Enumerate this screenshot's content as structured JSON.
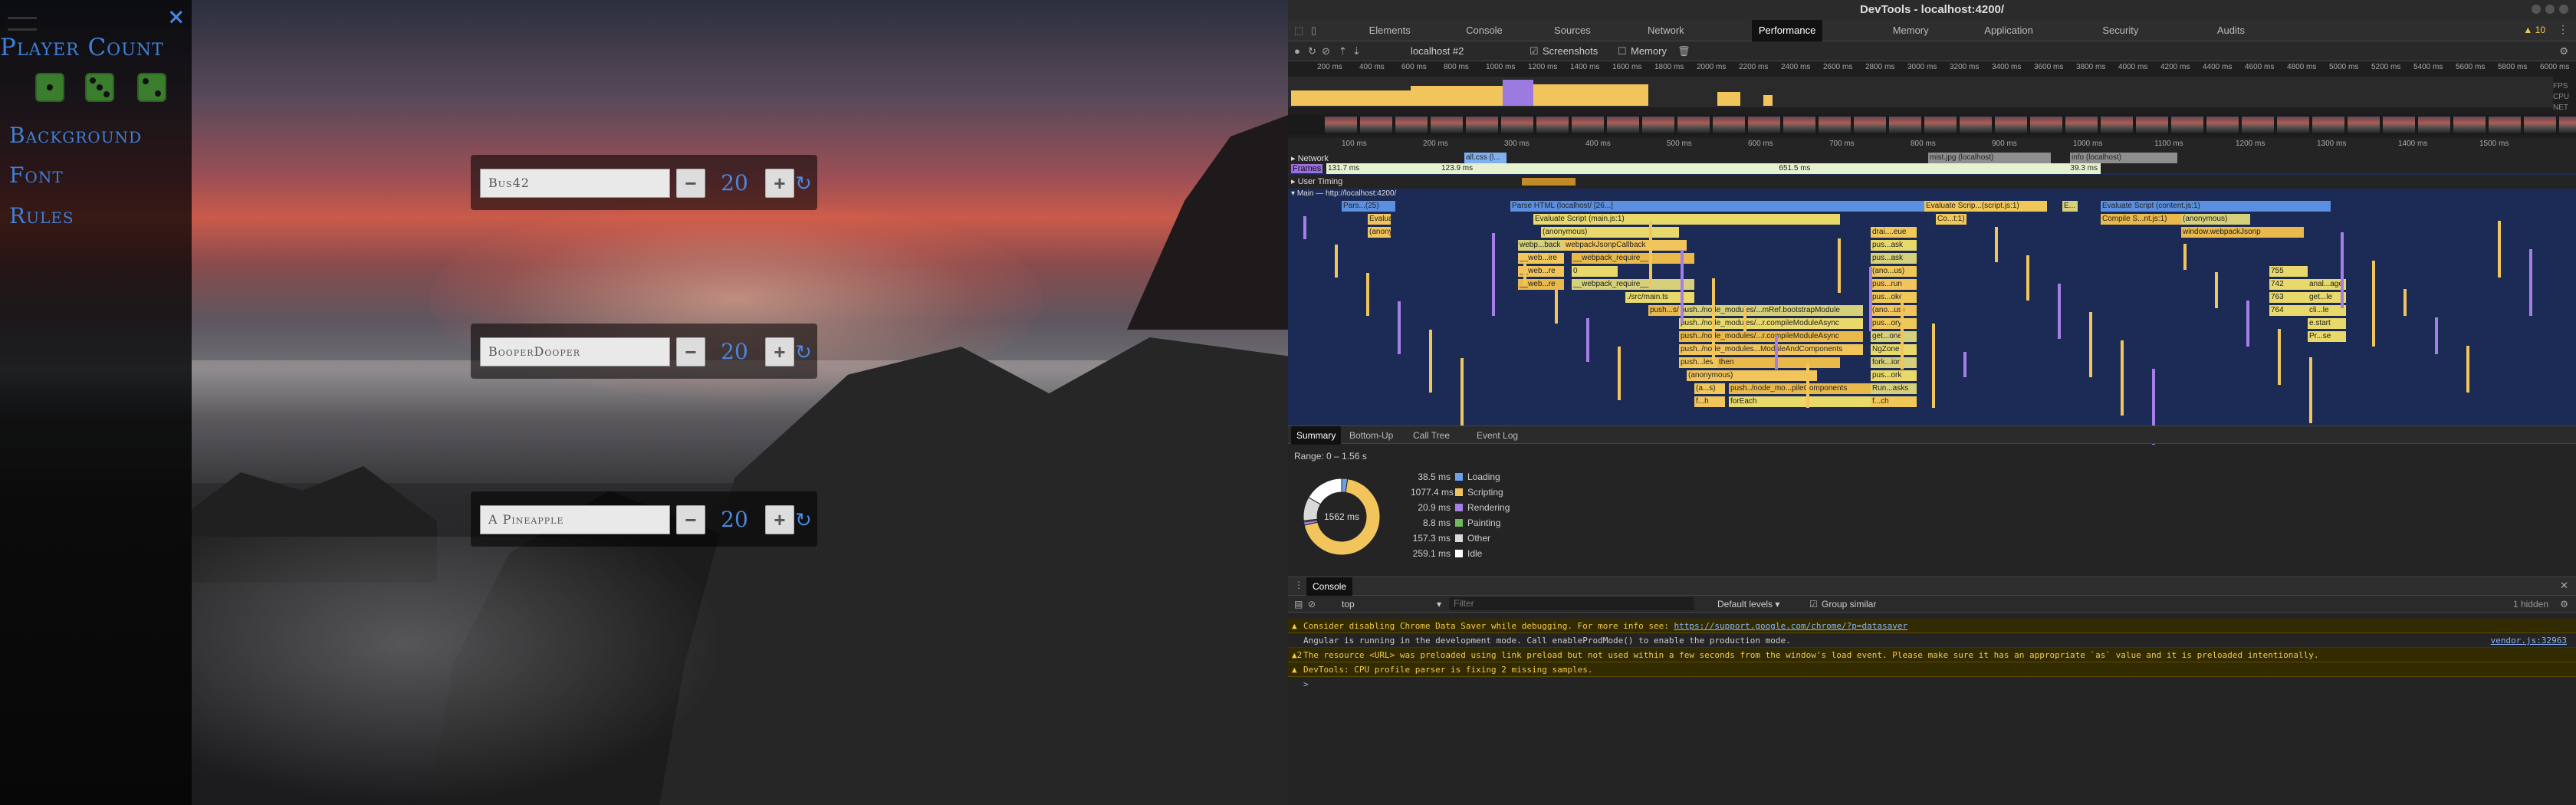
{
  "app": {
    "sidebar": {
      "title": "Player Count",
      "close_icon": "×",
      "dice": [
        {
          "dots": 1
        },
        {
          "dots": 3
        },
        {
          "dots": 2
        }
      ],
      "nav": [
        {
          "label": "Background"
        },
        {
          "label": "Font"
        },
        {
          "label": "Rules"
        }
      ]
    },
    "players": [
      {
        "name": "Bus42",
        "score": "20",
        "minus": "−",
        "plus": "+",
        "reset_icon": "↻"
      },
      {
        "name": "BooperDooper",
        "score": "20",
        "minus": "−",
        "plus": "+",
        "reset_icon": "↻"
      },
      {
        "name": "A Pineapple",
        "score": "20",
        "minus": "−",
        "plus": "+",
        "reset_icon": "↻"
      }
    ]
  },
  "devtools": {
    "window_title": "DevTools - localhost:4200/",
    "tabs": [
      "Elements",
      "Console",
      "Sources",
      "Network",
      "Performance",
      "Memory",
      "Application",
      "Security",
      "Audits"
    ],
    "active_tab": "Performance",
    "warning_count": "10",
    "toolbar": {
      "profile": "localhost #2",
      "screenshots_label": "Screenshots",
      "memory_label": "Memory"
    },
    "overview_ticks": [
      "200 ms",
      "400 ms",
      "600 ms",
      "800 ms",
      "1000 ms",
      "1200 ms",
      "1400 ms",
      "1600 ms",
      "1800 ms",
      "2000 ms",
      "2200 ms",
      "2400 ms",
      "2600 ms",
      "2800 ms",
      "3000 ms",
      "3200 ms",
      "3400 ms",
      "3600 ms",
      "3800 ms",
      "4000 ms",
      "4200 ms",
      "4400 ms",
      "4600 ms",
      "4800 ms",
      "5000 ms",
      "5200 ms",
      "5400 ms",
      "5600 ms",
      "5800 ms",
      "6000 ms"
    ],
    "overview_side_labels": [
      "FPS",
      "CPU",
      "NET"
    ],
    "detail_ticks": [
      "100 ms",
      "200 ms",
      "300 ms",
      "400 ms",
      "500 ms",
      "600 ms",
      "700 ms",
      "800 ms",
      "900 ms",
      "1000 ms",
      "1100 ms",
      "1200 ms",
      "1300 ms",
      "1400 ms",
      "1500 ms"
    ],
    "tracks": {
      "network": "Network",
      "network_items": [
        "all.css (l...",
        "mist.jpg (localhost)",
        "info (localhost)"
      ],
      "frames": "Frames",
      "frame_values": [
        "131.7 ms",
        "123.9 ms",
        "651.5 ms",
        "39.3 ms"
      ],
      "user_timing": "User Timing",
      "main": "Main — http://localhost:4200/"
    },
    "flame": [
      {
        "col": "Pars...(25)",
        "row": 0
      },
      {
        "col": "Parse HTML (localhost/ [26...]",
        "row": 0
      },
      {
        "col": "Evaluate Scrip...(script.js:1)",
        "row": 0
      },
      {
        "col": "Evaluate Script (content.js:1)",
        "row": 0
      },
      {
        "col": "E...",
        "row": 0
      },
      {
        "col": "Evalua...js:1)",
        "row": 1
      },
      {
        "col": "Evaluate Script (main.js:1)",
        "row": 1
      },
      {
        "col": "Co...t:1)",
        "row": 1
      },
      {
        "col": "Compile S...nt.js:1)",
        "row": 1
      },
      {
        "col": "(anonymous)",
        "row": 1
      },
      {
        "col": "(anonymous)",
        "row": 2
      },
      {
        "col": "(anonymous)",
        "row": 2
      },
      {
        "col": "drai....eue",
        "row": 2
      },
      {
        "col": "window.webpackJsonp",
        "row": 2
      },
      {
        "col": "webp...back",
        "row": 3
      },
      {
        "col": "webpackJsonpCallback",
        "row": 3
      },
      {
        "col": "pus...ask",
        "row": 3
      },
      {
        "col": "__web...ire",
        "row": 4
      },
      {
        "col": "__webpack_require__",
        "row": 4
      },
      {
        "col": "pus...ask",
        "row": 4
      },
      {
        "col": "__web...re",
        "row": 5
      },
      {
        "col": "0",
        "row": 5
      },
      {
        "col": "(ano...us)",
        "row": 5
      },
      {
        "col": "__web...re",
        "row": 6
      },
      {
        "col": "__webpack_require__",
        "row": 6
      },
      {
        "col": "pus...run",
        "row": 6
      },
      {
        "col": "./src/main.ts",
        "row": 7
      },
      {
        "col": "pus...oke",
        "row": 7
      },
      {
        "col": "push...s/node_modules/...nBrowserDynamic.js",
        "row": 8
      },
      {
        "col": "push../node_modules/...mRef.bootstrapModule",
        "row": 8
      },
      {
        "col": "(ano...us)",
        "row": 8
      },
      {
        "col": "push../node_modules/...r.compileModuleAsync",
        "row": 9
      },
      {
        "col": "pus...ory",
        "row": 9
      },
      {
        "col": "push../node_modules/...r.compileModuleAsync",
        "row": 10
      },
      {
        "col": "get...one",
        "row": 10
      },
      {
        "col": "push../node_modules...ModuleAndComponents",
        "row": 11
      },
      {
        "col": "NgZone",
        "row": 11
      },
      {
        "col": "push...les",
        "row": 12
      },
      {
        "col": "then",
        "row": 12
      },
      {
        "col": "fork...ior",
        "row": 12
      },
      {
        "col": "(anonymous)",
        "row": 13
      },
      {
        "col": "pus...ork",
        "row": 13
      },
      {
        "col": "(a...s)",
        "row": 14
      },
      {
        "col": "push../node_mo...pileComponents",
        "row": 14
      },
      {
        "col": "Run...asks",
        "row": 14
      },
      {
        "col": "f...h",
        "row": 15
      },
      {
        "col": "forEach",
        "row": 15
      },
      {
        "col": "f...ch",
        "row": 15
      }
    ],
    "flame_right_numbers": [
      "755",
      "742",
      "763",
      "764",
      "anal...age",
      "get...le",
      "cli...le",
      "e.start",
      "Pr...se"
    ],
    "bottom_tabs": [
      "Summary",
      "Bottom-Up",
      "Call Tree",
      "Event Log"
    ],
    "active_bottom_tab": "Summary",
    "range": "Range: 0 – 1.56 s",
    "total_label": "1562 ms",
    "summary": [
      {
        "value": "38.5 ms",
        "label": "Loading",
        "ms": 38.5,
        "color": "#6d9fe8"
      },
      {
        "value": "1077.4 ms",
        "label": "Scripting",
        "ms": 1077.4,
        "color": "#f2c55c"
      },
      {
        "value": "20.9 ms",
        "label": "Rendering",
        "ms": 20.9,
        "color": "#a77ee8"
      },
      {
        "value": "8.8 ms",
        "label": "Painting",
        "ms": 8.8,
        "color": "#70b85b"
      },
      {
        "value": "157.3 ms",
        "label": "Other",
        "ms": 157.3,
        "color": "#d9d9d9"
      },
      {
        "value": "259.1 ms",
        "label": "Idle",
        "ms": 259.1,
        "color": "#ffffff"
      }
    ],
    "console": {
      "tab": "Console",
      "context": "top",
      "filter_placeholder": "Filter",
      "levels": "Default levels ▾",
      "group_similar": "Group similar",
      "hidden": "1 hidden",
      "messages": [
        {
          "type": "warn",
          "text": "Consider disabling Chrome Data Saver while debugging. For more info see: ",
          "link": "https://support.google.com/chrome/?p=datasaver",
          "src": ""
        },
        {
          "type": "log",
          "text": "Angular is running in the development mode. Call enableProdMode() to enable the production mode.",
          "link": "",
          "src": "vendor.js:32963"
        },
        {
          "type": "warn",
          "text": "The resource <URL> was preloaded using link preload but not used within a few seconds from the window's load event. Please make sure it has an appropriate `as` value and it is preloaded intentionally.",
          "link": "",
          "src": "",
          "badge": "2"
        },
        {
          "type": "warn",
          "text": "DevTools: CPU profile parser is fixing 2 missing samples.",
          "link": "",
          "src": ""
        }
      ],
      "prompt": ">"
    }
  }
}
